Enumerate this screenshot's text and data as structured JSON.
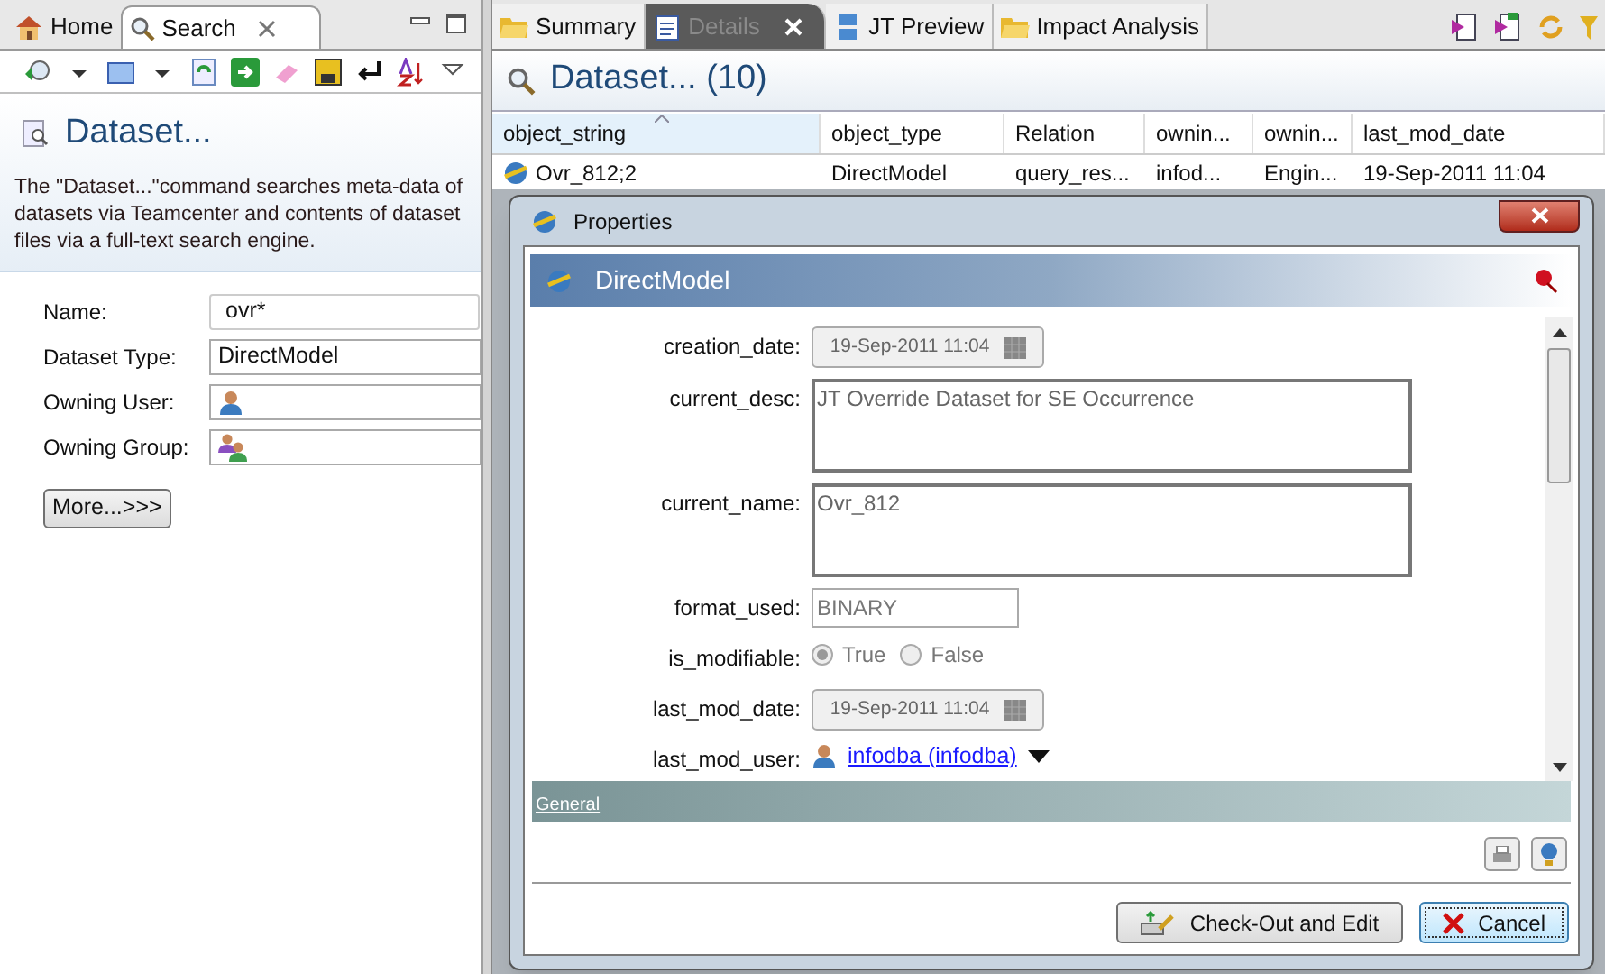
{
  "left_panel": {
    "tabs": [
      {
        "label": "Home",
        "selected": false
      },
      {
        "label": "Search",
        "selected": true
      }
    ],
    "title": "Dataset...",
    "description": "The \"Dataset...\"command searches meta-data of datasets via Teamcenter and contents of dataset files via a full-text search engine.",
    "fields": [
      {
        "label": "Name:",
        "value": "ovr*",
        "kind": "text"
      },
      {
        "label": "Dataset Type:",
        "value": "DirectModel",
        "kind": "text"
      },
      {
        "label": "Owning User:",
        "kind": "user"
      },
      {
        "label": "Owning Group:",
        "kind": "group"
      }
    ],
    "more_button": "More...>>>"
  },
  "right_panel": {
    "tabs": [
      {
        "label": "Summary",
        "selected": false
      },
      {
        "label": "Details",
        "selected": true
      },
      {
        "label": "JT Preview",
        "selected": false
      },
      {
        "label": "Impact Analysis",
        "selected": false
      }
    ],
    "title": "Dataset... (10)",
    "table": {
      "columns": [
        {
          "label": "object_string",
          "sorted": true
        },
        {
          "label": "object_type",
          "sorted": false
        },
        {
          "label": "Relation",
          "sorted": false
        },
        {
          "label": "ownin...",
          "sorted": false
        },
        {
          "label": "ownin...",
          "sorted": false
        },
        {
          "label": "last_mod_date",
          "sorted": false
        }
      ],
      "rows": [
        [
          "Ovr_812;2",
          "DirectModel",
          "query_res...",
          "infod...",
          "Engin...",
          "19-Sep-2011 11:04"
        ]
      ]
    }
  },
  "dialog": {
    "title": "Properties",
    "header": "DirectModel",
    "properties": [
      {
        "label": "creation_date:",
        "kind": "date",
        "value": "19-Sep-2011 11:04"
      },
      {
        "label": "current_desc:",
        "kind": "textarea",
        "value": "JT Override Dataset for SE Occurrence"
      },
      {
        "label": "current_name:",
        "kind": "textarea",
        "value": "Ovr_812"
      },
      {
        "label": "format_used:",
        "kind": "text",
        "value": "BINARY"
      },
      {
        "label": "is_modifiable:",
        "kind": "radio",
        "options": [
          {
            "label": "True",
            "selected": true
          },
          {
            "label": "False",
            "selected": false
          }
        ]
      },
      {
        "label": "last_mod_date:",
        "kind": "date",
        "value": "19-Sep-2011 11:04"
      },
      {
        "label": "last_mod_user:",
        "kind": "user",
        "value": "infodba (infodba)"
      }
    ],
    "section_link": "General",
    "buttons": [
      {
        "label": "Check-Out and Edit",
        "default": false
      },
      {
        "label": "Cancel",
        "default": true
      }
    ]
  }
}
